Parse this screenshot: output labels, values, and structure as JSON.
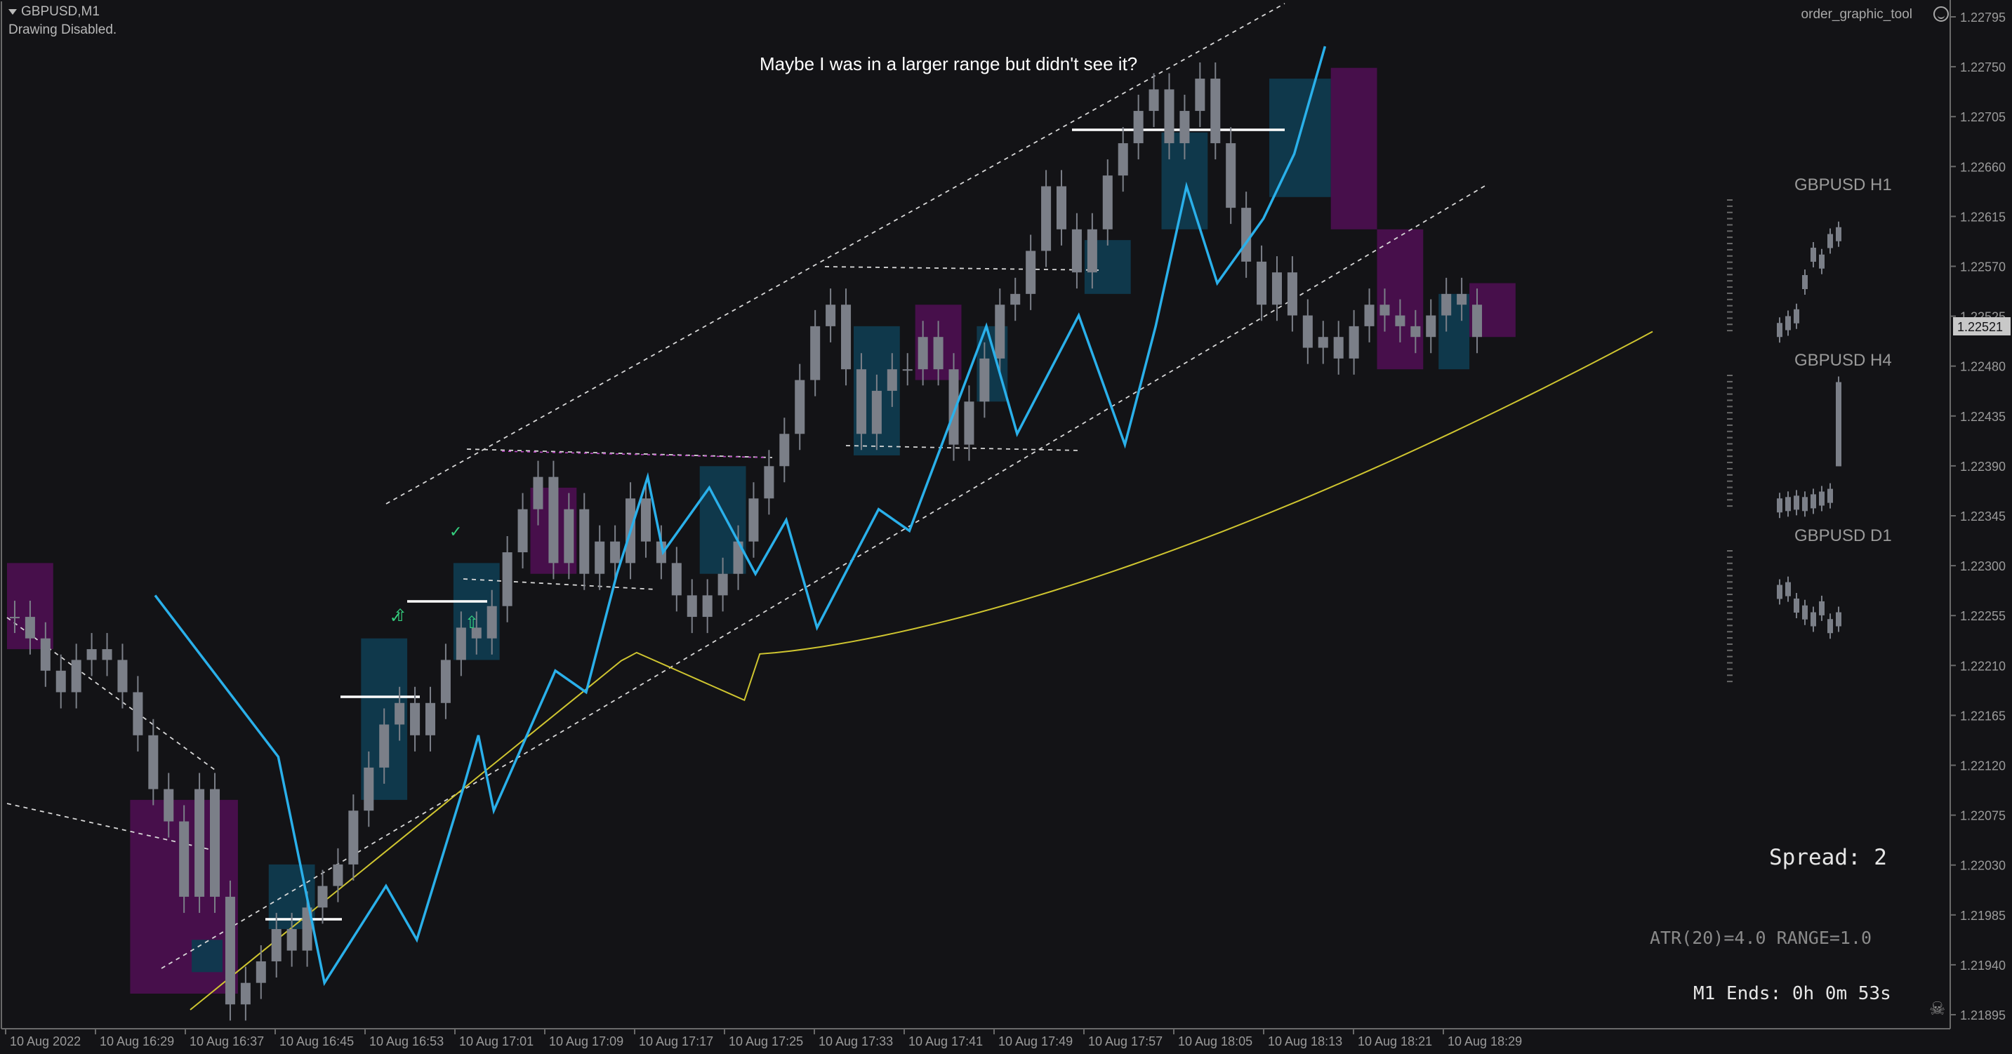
{
  "window": {
    "symbol_label": "GBPUSD,M1",
    "status_text": "Drawing Disabled.",
    "indicator_name": "order_graphic_tool",
    "smiley_icon": "smiley-icon"
  },
  "annotation": {
    "text": "Maybe I was in a larger range but didn't see it?"
  },
  "price_axis": {
    "labels": [
      "1.22795",
      "1.22750",
      "1.22705",
      "1.22660",
      "1.22615",
      "1.22570",
      "1.22525",
      "1.22480",
      "1.22435",
      "1.22390",
      "1.22345",
      "1.22300",
      "1.22255",
      "1.22210",
      "1.22165",
      "1.22120",
      "1.22075",
      "1.22030",
      "1.21985",
      "1.21940",
      "1.21895"
    ],
    "current_price": "1.22521"
  },
  "time_axis": {
    "labels": [
      "10 Aug 2022",
      "10 Aug 16:29",
      "10 Aug 16:37",
      "10 Aug 16:45",
      "10 Aug 16:53",
      "10 Aug 17:01",
      "10 Aug 17:09",
      "10 Aug 17:17",
      "10 Aug 17:25",
      "10 Aug 17:33",
      "10 Aug 17:41",
      "10 Aug 17:49",
      "10 Aug 17:57",
      "10 Aug 18:05",
      "10 Aug 18:13",
      "10 Aug 18:21",
      "10 Aug 18:29"
    ]
  },
  "mini_charts": [
    {
      "title": "GBPUSD H1"
    },
    {
      "title": "GBPUSD H4"
    },
    {
      "title": "GBPUSD D1"
    }
  ],
  "info_panel": {
    "spread": "Spread: 2",
    "atr_range": "ATR(20)=4.0   RANGE=1.0",
    "bar_timer": "M1 Ends: 0h 0m 53s"
  },
  "colors": {
    "background": "#131316",
    "bull_box": "#0f3a4e",
    "bear_box": "#4a0f4e",
    "candle": "#7b7f88",
    "zigzag": "#2ab0ea",
    "moving_average": "#cfc530",
    "grid_text": "#9a9a9a"
  },
  "chart_data": {
    "type": "candlestick",
    "ylim": [
      1.2188,
      1.2282
    ],
    "closes": [
      1.2226,
      1.2224,
      1.2221,
      1.2219,
      1.2222,
      1.2223,
      1.2222,
      1.2219,
      1.2215,
      1.221,
      1.2207,
      1.22,
      1.221,
      1.22,
      1.219,
      1.2192,
      1.2194,
      1.2197,
      1.2195,
      1.2199,
      1.2201,
      1.2203,
      1.2208,
      1.2212,
      1.2216,
      1.2218,
      1.2215,
      1.2218,
      1.2222,
      1.2225,
      1.2224,
      1.2227,
      1.2232,
      1.2236,
      1.2239,
      1.2231,
      1.2236,
      1.223,
      1.2233,
      1.2231,
      1.2237,
      1.2233,
      1.2231,
      1.2228,
      1.2226,
      1.2228,
      1.223,
      1.2233,
      1.2237,
      1.224,
      1.2243,
      1.2248,
      1.2253,
      1.2255,
      1.2249,
      1.2243,
      1.2247,
      1.2249,
      1.2249,
      1.2252,
      1.2249,
      1.2242,
      1.2246,
      1.225,
      1.2255,
      1.2256,
      1.226,
      1.2266,
      1.2262,
      1.2258,
      1.2262,
      1.2267,
      1.227,
      1.2273,
      1.2275,
      1.227,
      1.2273,
      1.2276,
      1.227,
      1.2264,
      1.2259,
      1.2255,
      1.2258,
      1.2254,
      1.2251,
      1.2252,
      1.225,
      1.2253,
      1.2255,
      1.2254,
      1.2253,
      1.2252,
      1.2254,
      1.2256,
      1.2255,
      1.2252
    ]
  }
}
